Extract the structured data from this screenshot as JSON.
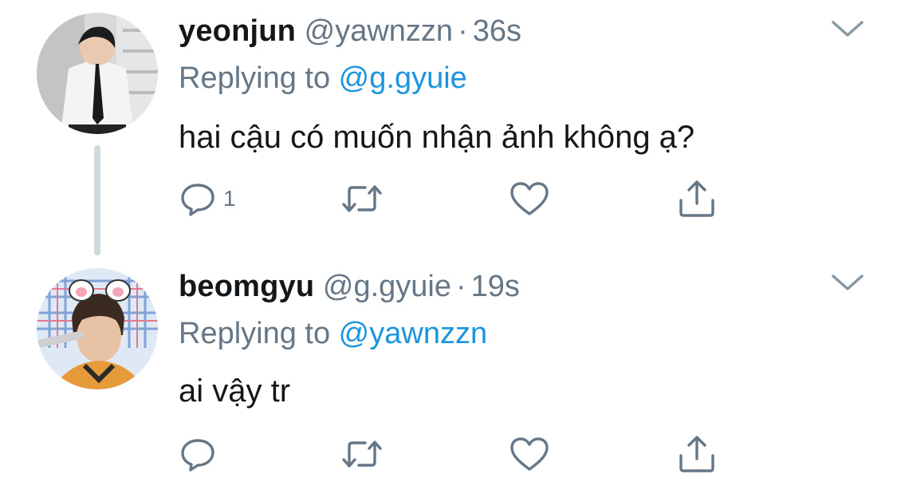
{
  "colors": {
    "text": "#14171a",
    "secondary": "#657786",
    "accent": "#1b95e0",
    "thread_line": "#cfd9de"
  },
  "tweets": [
    {
      "display_name": "yeonjun",
      "handle": "@yawnzzn",
      "separator": "·",
      "time": "36s",
      "replying_prefix": "Replying to ",
      "replying_to": "@g.gyuie",
      "text": "hai cậu có muốn nhận ảnh không ạ?",
      "reply_count": "1",
      "avatar": "profile-photo"
    },
    {
      "display_name": "beomgyu",
      "handle": "@g.gyuie",
      "separator": "·",
      "time": "19s",
      "replying_prefix": "Replying to ",
      "replying_to": "@yawnzzn",
      "text": "ai vậy tr",
      "reply_count": "",
      "avatar": "profile-photo"
    }
  ],
  "icons": [
    "reply-icon",
    "retweet-icon",
    "like-icon",
    "share-icon",
    "chevron-down-icon"
  ]
}
